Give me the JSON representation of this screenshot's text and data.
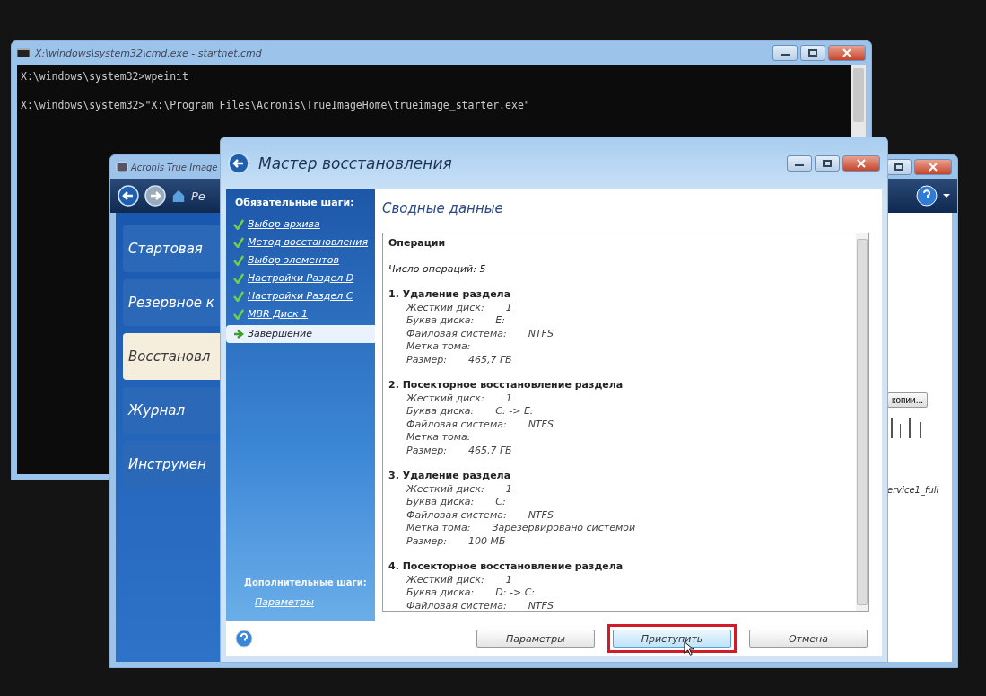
{
  "cmd_window": {
    "title": "X:\\windows\\system32\\cmd.exe - startnet.cmd",
    "lines": [
      "X:\\windows\\system32>wpeinit",
      "X:\\windows\\system32>\"X:\\Program Files\\Acronis\\TrueImageHome\\trueimage_starter.exe\""
    ]
  },
  "main_window": {
    "title": "Acronis True Image",
    "toolbar_label": "Ре",
    "nav_items": [
      {
        "label": "Стартовая",
        "selected": false
      },
      {
        "label": "Резервное к",
        "selected": false
      },
      {
        "label": "Восстановл",
        "selected": true
      },
      {
        "label": "Журнал",
        "selected": false
      },
      {
        "label": "Инструмен",
        "selected": false
      }
    ],
    "button": "копии...",
    "file_label": "ervice1_full"
  },
  "wizard": {
    "title": "Мастер восстановления",
    "required_heading": "Обязательные шаги:",
    "steps": [
      {
        "label": "Выбор архива",
        "kind": "done"
      },
      {
        "label": "Метод восстановления",
        "kind": "done"
      },
      {
        "label": "Выбор элементов",
        "kind": "done"
      },
      {
        "label": "Настройки Раздел D",
        "kind": "done"
      },
      {
        "label": "Настройки Раздел C",
        "kind": "done"
      },
      {
        "label": "MBR Диск 1",
        "kind": "done"
      },
      {
        "label": "Завершение",
        "kind": "current"
      }
    ],
    "optional_heading": "Дополнительные шаги:",
    "optional_steps": [
      "Параметры"
    ],
    "section_title": "Сводные данные",
    "summary": {
      "heading": "Операции",
      "count": "Число операций: 5",
      "operations": [
        {
          "title": "1. Удаление раздела",
          "fields": [
            {
              "label": "Жесткий диск:",
              "value": "1"
            },
            {
              "label": "Буква диска:",
              "value": "E:"
            },
            {
              "label": "Файловая система:",
              "value": "NTFS"
            },
            {
              "label": "Метка тома:"
            },
            {
              "label": "Размер:",
              "value": "465,7 ГБ"
            }
          ]
        },
        {
          "title": "2. Посекторное восстановление раздела",
          "fields": [
            {
              "label": "Жесткий диск:",
              "value": "1"
            },
            {
              "label": "Буква диска:",
              "value": "C: -> E:"
            },
            {
              "label": "Файловая система:",
              "value": "NTFS"
            },
            {
              "label": "Метка тома:"
            },
            {
              "label": "Размер:",
              "value": "465,7 ГБ"
            }
          ]
        },
        {
          "title": "3. Удаление раздела",
          "fields": [
            {
              "label": "Жесткий диск:",
              "value": "1"
            },
            {
              "label": "Буква диска:",
              "value": "C:"
            },
            {
              "label": "Файловая система:",
              "value": "NTFS"
            },
            {
              "label": "Метка тома:",
              "value": "Зарезервировано системой"
            },
            {
              "label": "Размер:",
              "value": "100 МБ"
            }
          ]
        },
        {
          "title": "4. Посекторное восстановление раздела",
          "fields": [
            {
              "label": "Жесткий диск:",
              "value": "1"
            },
            {
              "label": "Буква диска:",
              "value": "D: -> C:"
            },
            {
              "label": "Файловая система:",
              "value": "NTFS"
            }
          ]
        }
      ]
    },
    "buttons": [
      {
        "label": "Параметры",
        "highlighted": false
      },
      {
        "label": "Приступить",
        "highlighted": true
      },
      {
        "label": "Отмена",
        "highlighted": false
      }
    ]
  }
}
